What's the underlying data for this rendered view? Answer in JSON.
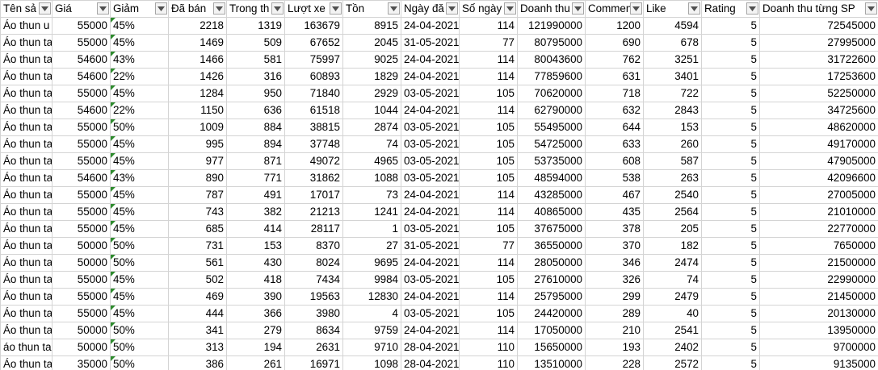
{
  "columns": [
    {
      "label": "Tên sả",
      "align": "txt"
    },
    {
      "label": "Giá",
      "align": "num"
    },
    {
      "label": "Giảm",
      "align": "txt"
    },
    {
      "label": "Đã bán",
      "align": "num"
    },
    {
      "label": "Trong th",
      "align": "num"
    },
    {
      "label": "Lượt xe",
      "align": "num"
    },
    {
      "label": "Tồn",
      "align": "num"
    },
    {
      "label": "Ngày đă",
      "align": "txt"
    },
    {
      "label": "Số ngày",
      "align": "num"
    },
    {
      "label": "Doanh thu",
      "align": "num"
    },
    {
      "label": "Commen",
      "align": "num"
    },
    {
      "label": "Like",
      "align": "num"
    },
    {
      "label": "Rating",
      "align": "num"
    },
    {
      "label": "Doanh thu từng SP",
      "align": "num"
    }
  ],
  "rows": [
    [
      "Áo thun u",
      "55000",
      "45%",
      "2218",
      "1319",
      "163679",
      "8915",
      "24-04-2021",
      "114",
      "121990000",
      "1200",
      "4594",
      "5",
      "72545000"
    ],
    [
      "Áo thun ta",
      "55000",
      "45%",
      "1469",
      "509",
      "67652",
      "2045",
      "31-05-2021",
      "77",
      "80795000",
      "690",
      "678",
      "5",
      "27995000"
    ],
    [
      "Áo thun ta",
      "54600",
      "43%",
      "1466",
      "581",
      "75997",
      "9025",
      "24-04-2021",
      "114",
      "80043600",
      "762",
      "3251",
      "5",
      "31722600"
    ],
    [
      "Áo thun ta",
      "54600",
      "22%",
      "1426",
      "316",
      "60893",
      "1829",
      "24-04-2021",
      "114",
      "77859600",
      "631",
      "3401",
      "5",
      "17253600"
    ],
    [
      "Áo thun ta",
      "55000",
      "45%",
      "1284",
      "950",
      "71840",
      "2929",
      "03-05-2021",
      "105",
      "70620000",
      "718",
      "722",
      "5",
      "52250000"
    ],
    [
      "Áo thun ta",
      "54600",
      "22%",
      "1150",
      "636",
      "61518",
      "1044",
      "24-04-2021",
      "114",
      "62790000",
      "632",
      "2843",
      "5",
      "34725600"
    ],
    [
      "Áo thun ta",
      "55000",
      "50%",
      "1009",
      "884",
      "38815",
      "2874",
      "03-05-2021",
      "105",
      "55495000",
      "644",
      "153",
      "5",
      "48620000"
    ],
    [
      "Áo thun ta",
      "55000",
      "45%",
      "995",
      "894",
      "37748",
      "74",
      "03-05-2021",
      "105",
      "54725000",
      "633",
      "260",
      "5",
      "49170000"
    ],
    [
      "Áo thun ta",
      "55000",
      "45%",
      "977",
      "871",
      "49072",
      "4965",
      "03-05-2021",
      "105",
      "53735000",
      "608",
      "587",
      "5",
      "47905000"
    ],
    [
      "Áo thun ta",
      "54600",
      "43%",
      "890",
      "771",
      "31862",
      "1088",
      "03-05-2021",
      "105",
      "48594000",
      "538",
      "263",
      "5",
      "42096600"
    ],
    [
      "Áo thun ta",
      "55000",
      "45%",
      "787",
      "491",
      "17017",
      "73",
      "24-04-2021",
      "114",
      "43285000",
      "467",
      "2540",
      "5",
      "27005000"
    ],
    [
      "Áo thun ta",
      "55000",
      "45%",
      "743",
      "382",
      "21213",
      "1241",
      "24-04-2021",
      "114",
      "40865000",
      "435",
      "2564",
      "5",
      "21010000"
    ],
    [
      "Áo thun ta",
      "55000",
      "45%",
      "685",
      "414",
      "28117",
      "1",
      "03-05-2021",
      "105",
      "37675000",
      "378",
      "205",
      "5",
      "22770000"
    ],
    [
      "Áo thun ta",
      "50000",
      "50%",
      "731",
      "153",
      "8370",
      "27",
      "31-05-2021",
      "77",
      "36550000",
      "370",
      "182",
      "5",
      "7650000"
    ],
    [
      "Áo thun ta",
      "50000",
      "50%",
      "561",
      "430",
      "8024",
      "9695",
      "24-04-2021",
      "114",
      "28050000",
      "346",
      "2474",
      "5",
      "21500000"
    ],
    [
      "Áo thun ta",
      "55000",
      "45%",
      "502",
      "418",
      "7434",
      "9984",
      "03-05-2021",
      "105",
      "27610000",
      "326",
      "74",
      "5",
      "22990000"
    ],
    [
      "Áo thun ta",
      "55000",
      "45%",
      "469",
      "390",
      "19563",
      "12830",
      "24-04-2021",
      "114",
      "25795000",
      "299",
      "2479",
      "5",
      "21450000"
    ],
    [
      "Áo thun ta",
      "55000",
      "45%",
      "444",
      "366",
      "3980",
      "4",
      "03-05-2021",
      "105",
      "24420000",
      "289",
      "40",
      "5",
      "20130000"
    ],
    [
      "Áo thun ta",
      "50000",
      "50%",
      "341",
      "279",
      "8634",
      "9759",
      "24-04-2021",
      "114",
      "17050000",
      "210",
      "2541",
      "5",
      "13950000"
    ],
    [
      "áo thun ta",
      "50000",
      "50%",
      "313",
      "194",
      "2631",
      "9710",
      "28-04-2021",
      "110",
      "15650000",
      "193",
      "2402",
      "5",
      "9700000"
    ],
    [
      "Áo thun ta",
      "35000",
      "50%",
      "386",
      "261",
      "16971",
      "1098",
      "28-04-2021",
      "110",
      "13510000",
      "228",
      "2572",
      "5",
      "9135000"
    ]
  ],
  "icons": {
    "filter": "filter-dropdown-icon",
    "error_marker": "green-triangle-icon"
  },
  "colors": {
    "grid": "#d4d4d4",
    "error_marker": "#2e8b2e"
  }
}
